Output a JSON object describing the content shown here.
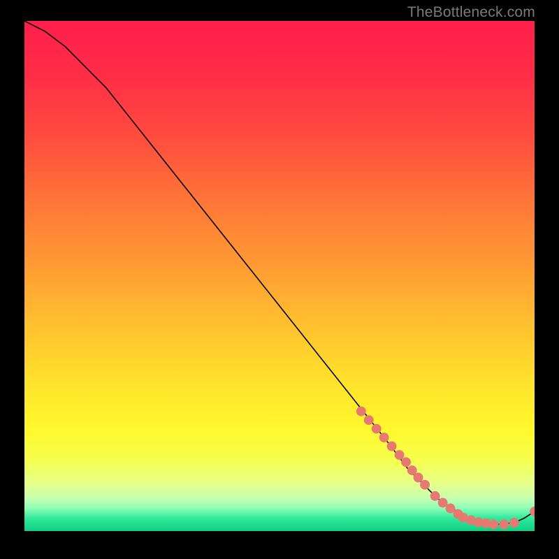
{
  "watermark": "TheBottleneck.com",
  "chart_data": {
    "type": "line",
    "title": "",
    "xlabel": "",
    "ylabel": "",
    "xlim": [
      0,
      100
    ],
    "ylim": [
      0,
      100
    ],
    "grid": false,
    "series": [
      {
        "name": "curve",
        "x": [
          0,
          4,
          8,
          12,
          16,
          20,
          24,
          28,
          32,
          36,
          40,
          44,
          48,
          52,
          56,
          60,
          64,
          68,
          72,
          75,
          78,
          81,
          84,
          87,
          90,
          93,
          96,
          98,
          100
        ],
        "y": [
          100,
          98,
          95,
          91,
          87,
          82,
          77,
          72,
          67,
          62,
          57,
          52,
          47,
          42,
          37,
          32,
          27,
          22,
          17,
          13,
          10,
          7,
          5,
          3,
          2.2,
          2.0,
          2.3,
          3.2,
          4.5
        ]
      }
    ],
    "markers": {
      "name": "dots",
      "x": [
        66,
        67.5,
        69,
        70.5,
        72,
        73.5,
        74.8,
        76,
        77.2,
        78.5,
        80.5,
        82,
        83.5,
        85,
        86,
        87.5,
        89,
        90.5,
        92,
        94,
        96,
        100
      ],
      "y": [
        24,
        22.3,
        20.6,
        18.9,
        17.2,
        15.5,
        14.1,
        12.5,
        11.1,
        9.7,
        7.5,
        6.2,
        5.1,
        4.0,
        3.3,
        2.8,
        2.4,
        2.2,
        2.0,
        2.0,
        2.3,
        4.5
      ]
    },
    "gradient_stops": [
      {
        "offset": 0.0,
        "color": "#ff1f4b"
      },
      {
        "offset": 0.1,
        "color": "#ff2c47"
      },
      {
        "offset": 0.22,
        "color": "#ff4a3f"
      },
      {
        "offset": 0.35,
        "color": "#ff7538"
      },
      {
        "offset": 0.48,
        "color": "#ff9b33"
      },
      {
        "offset": 0.6,
        "color": "#ffc22f"
      },
      {
        "offset": 0.72,
        "color": "#ffe52c"
      },
      {
        "offset": 0.8,
        "color": "#fff82b"
      },
      {
        "offset": 0.86,
        "color": "#f5ff4e"
      },
      {
        "offset": 0.905,
        "color": "#e8ff88"
      },
      {
        "offset": 0.935,
        "color": "#c8ffb0"
      },
      {
        "offset": 0.955,
        "color": "#8effb8"
      },
      {
        "offset": 0.975,
        "color": "#30e99a"
      },
      {
        "offset": 1.0,
        "color": "#0fcf85"
      }
    ],
    "marker_color": "#e67a72",
    "curve_color": "#000000"
  }
}
